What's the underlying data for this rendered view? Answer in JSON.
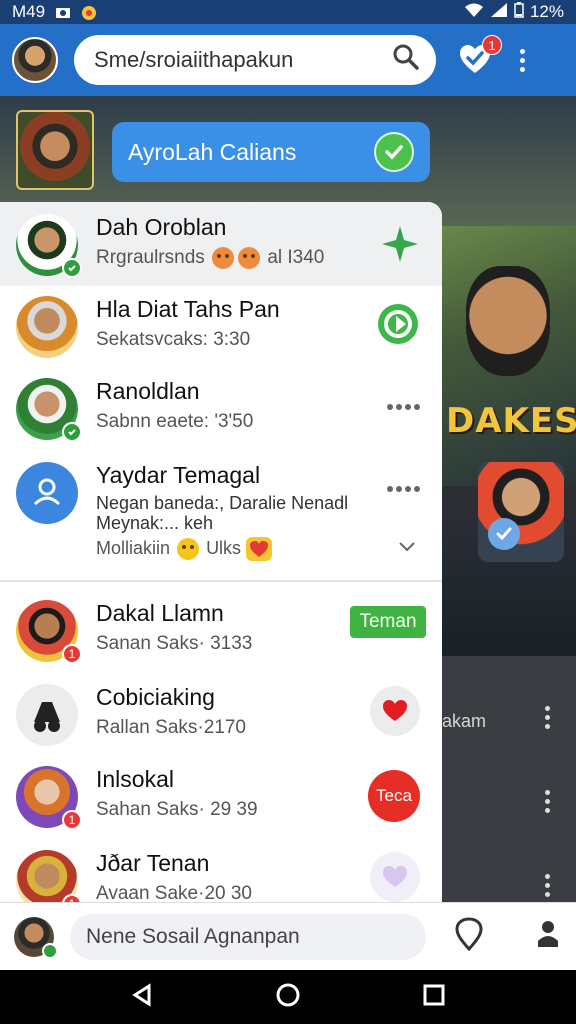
{
  "status_bar": {
    "carrier": "M49",
    "battery": "12%"
  },
  "app_bar": {
    "search_text": "Sme/sroiaiithapakun",
    "notification_count": "1"
  },
  "story": {
    "pill_label": "AyroLah Calians"
  },
  "background": {
    "poster_title": "DAKES",
    "side_text": "akam"
  },
  "chats": [
    {
      "name": "Dah Oroblan",
      "sub_text": "Rrgraulrsnds",
      "sub_suffix": "al I340"
    },
    {
      "name": "Hla Diat Tahs Pan",
      "sub_text": "Sekatsvcaks: 3:30"
    },
    {
      "name": "Ranoldlan",
      "sub_text": "Sabnn eaete: '3'50"
    },
    {
      "name": "Yaydar Temagal",
      "sub_text": "Negan baneda:, Daralie Nenadl Meynak:... keh",
      "sub_text_2": "Molliakiin",
      "sub_text_2_suffix": "Ulks"
    },
    {
      "name": "Dakal Llamn",
      "sub_text": "Sanan Saks· 3133",
      "tag": "Teman"
    },
    {
      "name": "Cobiciaking",
      "sub_text": "Rallan Saks·2170"
    },
    {
      "name": "Inlsokal",
      "sub_text": "Sahan Saks· 29 39",
      "button": "Teca"
    },
    {
      "name": "Jðar Tenan",
      "sub_text": "Avaan Sake·20 30"
    }
  ],
  "bottom_bar": {
    "placeholder": "Nene Sosail Agnanpan"
  }
}
